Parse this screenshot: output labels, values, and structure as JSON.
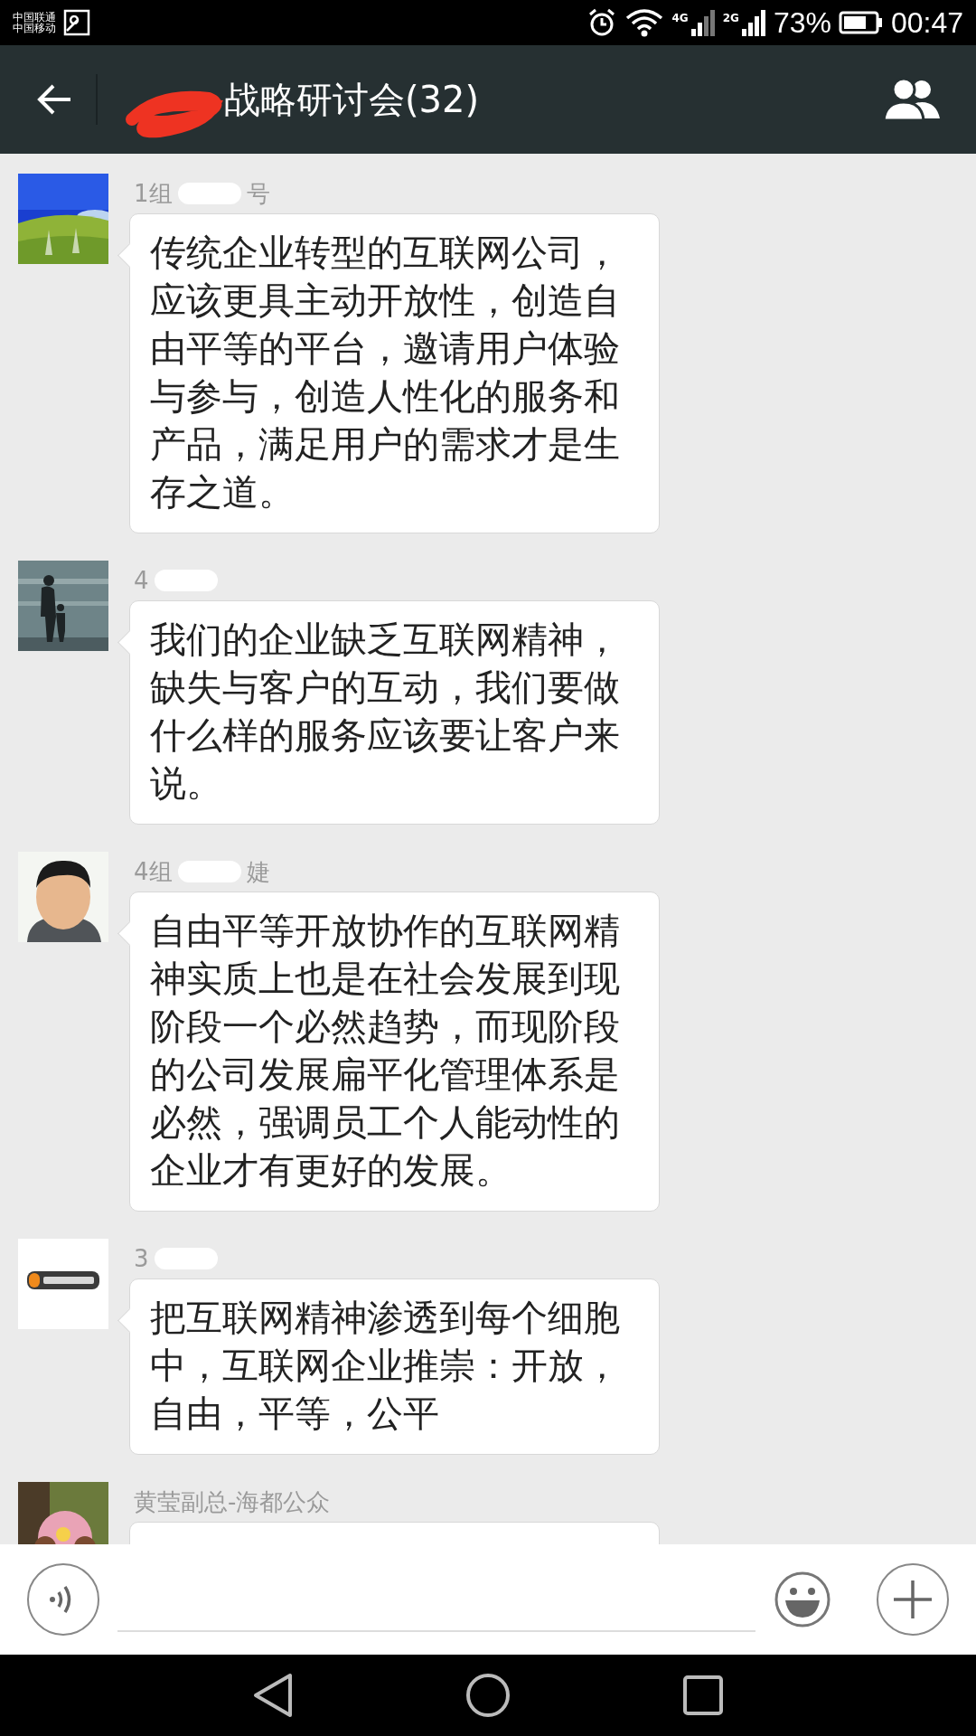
{
  "status_bar": {
    "carriers": [
      "中国联通",
      "中国移动"
    ],
    "network_1": "4G",
    "network_2": "2G",
    "battery": "73%",
    "time": "00:47"
  },
  "header": {
    "title": "战略研讨会(32)",
    "title_redacted": true
  },
  "messages": [
    {
      "avatar": {
        "kind": "picture"
      },
      "name_parts": [
        "1组",
        "号"
      ],
      "redacted": true,
      "text": "传统企业转型的互联网公司，应该更具主动开放性，创造自由平等的平台，邀请用户体验与参与，创造人性化的服务和产品，满足用户的需求才是生存之道。"
    },
    {
      "avatar": {
        "kind": "picture"
      },
      "name_parts": [
        "4"
      ],
      "redacted": true,
      "text": "我们的企业缺乏互联网精神，缺失与客户的互动，我们要做什么样的服务应该要让客户来说。"
    },
    {
      "avatar": {
        "kind": "picture"
      },
      "name_parts": [
        "4组",
        "婕"
      ],
      "redacted": true,
      "text": "自由平等开放协作的互联网精神实质上也是在社会发展到现阶段一个必然趋势，而现阶段的公司发展扁平化管理体系是必然，强调员工个人能动性的企业才有更好的发展。"
    },
    {
      "avatar": {
        "kind": "picture"
      },
      "name_parts": [
        "3"
      ],
      "redacted": true,
      "text": "把互联网精神渗透到每个细胞中，互联网企业推崇：开放，自由，平等，公平"
    },
    {
      "avatar": {
        "kind": "picture"
      },
      "name_parts": [
        "黄莹副总-海都公众"
      ],
      "redacted": false
    }
  ]
}
